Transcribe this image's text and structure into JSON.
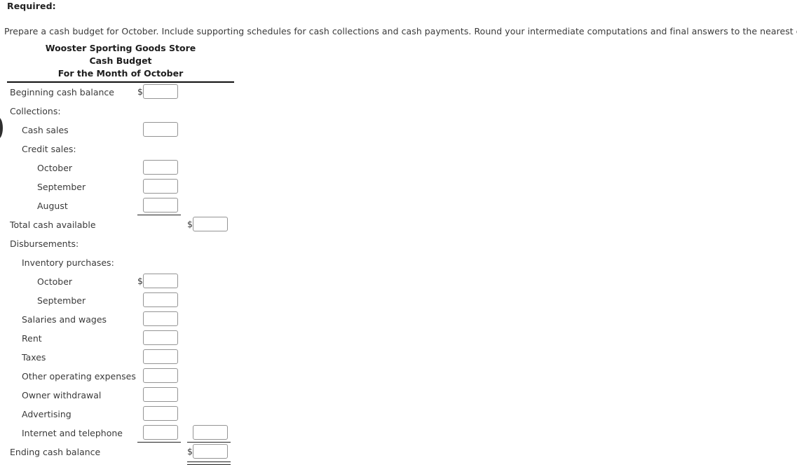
{
  "intro": {
    "required_heading": "Required:",
    "instruction": "Prepare a cash budget for October. Include supporting schedules for cash collections and cash payments. Round your intermediate computations and final answers to the nearest dollar."
  },
  "statement": {
    "company": "Wooster Sporting Goods Store",
    "report": "Cash Budget",
    "period": "For the Month of October",
    "currency_symbol": "$"
  },
  "rows": [
    {
      "label": "Beginning cash balance",
      "indent": 0
    },
    {
      "label": "Collections:",
      "indent": 0
    },
    {
      "label": "Cash sales",
      "indent": 1
    },
    {
      "label": "Credit sales:",
      "indent": 1
    },
    {
      "label": "October",
      "indent": 2
    },
    {
      "label": "September",
      "indent": 2
    },
    {
      "label": "August",
      "indent": 2
    },
    {
      "label": "Total cash available",
      "indent": 0
    },
    {
      "label": "Disbursements:",
      "indent": 0
    },
    {
      "label": "Inventory purchases:",
      "indent": 1
    },
    {
      "label": "October",
      "indent": 2
    },
    {
      "label": "September",
      "indent": 2
    },
    {
      "label": "Salaries and wages",
      "indent": 1
    },
    {
      "label": "Rent",
      "indent": 1
    },
    {
      "label": "Taxes",
      "indent": 1
    },
    {
      "label": "Other operating expenses",
      "indent": 1
    },
    {
      "label": "Owner withdrawal",
      "indent": 1
    },
    {
      "label": "Advertising",
      "indent": 1
    },
    {
      "label": "Internet and telephone",
      "indent": 1
    },
    {
      "label": "Ending cash balance",
      "indent": 0
    }
  ],
  "inputs": {
    "beginning_cash_balance": "",
    "cash_sales": "",
    "credit_sales_october": "",
    "credit_sales_september": "",
    "credit_sales_august": "",
    "total_cash_available": "",
    "inventory_october": "",
    "inventory_september": "",
    "salaries_and_wages": "",
    "rent": "",
    "taxes": "",
    "other_operating_expenses": "",
    "owner_withdrawal": "",
    "advertising": "",
    "internet_and_telephone": "",
    "total_disbursements": "",
    "ending_cash_balance": ""
  },
  "placeholder": ""
}
